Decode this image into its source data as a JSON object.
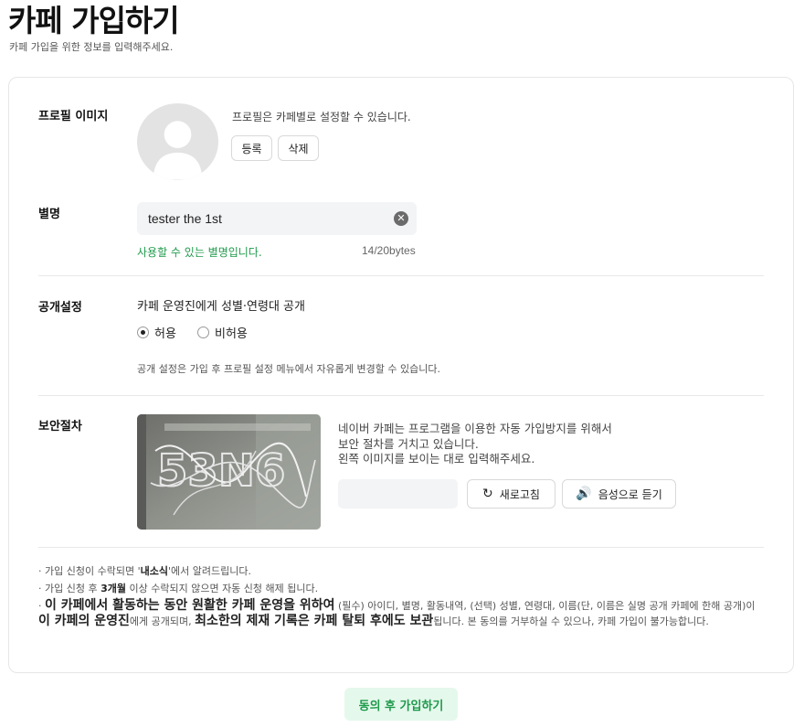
{
  "header": {
    "title": "카페 가입하기",
    "subtitle": "카페 가입을 위한 정보를 입력해주세요."
  },
  "profile": {
    "label": "프로필 이미지",
    "description": "프로필은 카페별로 설정할 수 있습니다.",
    "register_label": "등록",
    "delete_label": "삭제"
  },
  "nickname": {
    "label": "별명",
    "value": "tester the 1st",
    "status": "사용할 수 있는 별명입니다.",
    "byte_count": "14/20bytes",
    "clear_icon": "circle-x-icon"
  },
  "disclosure": {
    "label": "공개설정",
    "title": "카페 운영진에게 성별·연령대 공개",
    "options": [
      {
        "label": "허용",
        "selected": true
      },
      {
        "label": "비허용",
        "selected": false
      }
    ],
    "note": "공개 설정은 가입 후 프로필 설정 메뉴에서 자유롭게 변경할 수 있습니다."
  },
  "security": {
    "label": "보안절차",
    "desc_lines": [
      "네이버 카페는 프로그램을 이용한 자동 가입방지를 위해서",
      "보안 절차를 거치고 있습니다.",
      "왼쪽 이미지를 보이는 대로 입력해주세요."
    ],
    "input_value": "",
    "refresh_label": "새로고침",
    "refresh_icon": "refresh-icon",
    "audio_label": "음성으로 듣기",
    "audio_icon": "speaker-icon",
    "captcha_text": "53N6"
  },
  "notes": {
    "n1_pre": "가입 신청이 수락되면 '",
    "n1_bold": "내소식",
    "n1_post": "'에서 알려드립니다.",
    "n2_pre": "가입 신청 후 ",
    "n2_bold": "3개월",
    "n2_post": " 이상 수락되지 않으면 자동 신청 해제 됩니다.",
    "n3_big1": "이 카페에서 활동하는 동안 원활한 카페 운영을 위하여",
    "n3_t1": " (필수) 아이디, 별명, 활동내역, (선택) 성별, 연령대, 이름(단, 이름은 실명 공개 카페에 한해 공개)이 ",
    "n3_big2": "이 카페의 운영진",
    "n3_t2": "에게 공개되며, ",
    "n3_big3": "최소한의 제재 기록은 카페 탈퇴 후에도 보관",
    "n3_t3": "됩니다. 본 동의를 거부하실 수 있으나, 카페 가입이 불가능합니다."
  },
  "submit_label": "동의 후 가입하기",
  "colors": {
    "accent_green": "#1f9a4c",
    "submit_bg": "#e5f8ec"
  }
}
